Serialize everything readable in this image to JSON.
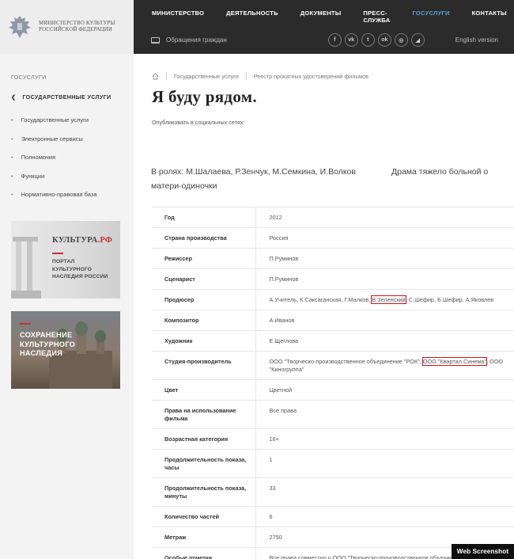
{
  "brand": {
    "name_line1": "МИНИСТЕРСТВО КУЛЬТУРЫ",
    "name_line2": "РОССИЙСКОЙ ФЕДЕРАЦИИ"
  },
  "topnav": {
    "items": [
      "МИНИСТЕРСТВО",
      "ДЕЯТЕЛЬНОСТЬ",
      "ДОКУМЕНТЫ",
      "ПРЕСС-СЛУЖБА",
      "ГОСУСЛУГИ",
      "КОНТАКТЫ"
    ],
    "active_index": 4,
    "appeal": "Обращения граждан",
    "english": "English version",
    "socials": [
      "f",
      "vk",
      "t",
      "ok",
      "ig",
      "rss"
    ]
  },
  "sidebar": {
    "title": "ГОСУСЛУГИ",
    "back": "ГОСУДАРСТВЕННЫЕ УСЛУГИ",
    "items": [
      "Государственные услуги",
      "Электронные сервисы",
      "Полномочия",
      "Функции",
      "Нормативно-правовая база"
    ],
    "banner1": {
      "title": "КУЛЬТУРА",
      "title_suffix": ".РФ",
      "text": "ПОРТАЛ\nКУЛЬТУРНОГО\nНАСЛЕДИЯ РОССИИ"
    },
    "banner2": {
      "text": "СОХРАНЕНИЕ\nКУЛЬТУРНОГО\nНАСЛЕДИЯ"
    }
  },
  "breadcrumbs": [
    "Государственные услуги",
    "Реестр прокатных удостоверений фильмов"
  ],
  "page": {
    "title": "Я буду рядом.",
    "share_label": "Опубликовать в социальных сетях:",
    "desc_left_line1": "В ролях: М.Шалаева, Р.Зенчук, М.Семкина, И.Волков",
    "desc_left_line2": "матери-одиночки",
    "desc_right": "Драма тяжело больной о"
  },
  "details": {
    "year_label": "Год",
    "year": "2012",
    "country_label": "Страна производства",
    "country": "Россия",
    "director_label": "Режиссер",
    "director": "П.Руминов",
    "writer_label": "Сценарист",
    "writer": "П.Руминов",
    "producer_label": "Продюсер",
    "producer_a": "А.Учитель, К.Саксаганская, Г.Малков, ",
    "producer_hl": "В.Зеленский",
    "producer_b": ", С.Шефир, Б.Шефир, А.Яковлев",
    "composer_label": "Композитор",
    "composer": "А.Иванов",
    "artist_label": "Художник",
    "artist": "Е.Щеглова",
    "studio_label": "Студия-производитель",
    "studio_a": "ООО \"Творческо-производственное объединение \"РОК\", ",
    "studio_hl": "ООО \"Квартал Синема\"",
    "studio_b": ", ООО \"Киногруппа\"",
    "color_label": "Цвет",
    "color": "Цветной",
    "rights_label": "Права на использование фильма",
    "rights": "Все права",
    "age_label": "Возрастная категория",
    "age": "16+",
    "hours_label": "Продолжительность показа, часы",
    "hours": "1",
    "minutes_label": "Продолжительность показа, минуты",
    "minutes": "33",
    "parts_label": "Количество частей",
    "parts": "6",
    "meterage_label": "Метраж",
    "meterage": "2750",
    "notes_label": "Особые отметки",
    "notes": "Все права совместно у ООО \"Творческо-производственное объединение \"РОК\", ООО \"Квартал Синема\""
  },
  "watermark": "Web Screenshot",
  "colors": {
    "accent": "#c8302e",
    "highlight": "#d3101d",
    "topbar": "#2b2b2b",
    "active_nav": "#5ea1d8"
  }
}
